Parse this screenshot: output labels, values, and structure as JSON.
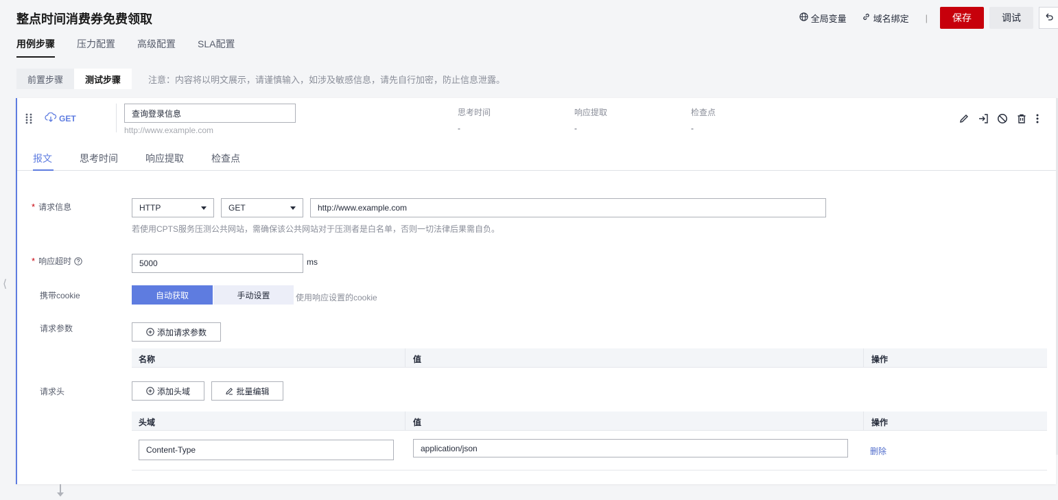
{
  "header": {
    "title": "整点时间消费券免费领取",
    "global_vars": "全局变量",
    "domain_bind": "域名绑定",
    "separator": "|",
    "save": "保存",
    "debug": "调试"
  },
  "main_tabs": [
    {
      "label": "用例步骤",
      "active": true
    },
    {
      "label": "压力配置",
      "active": false
    },
    {
      "label": "高级配置",
      "active": false
    },
    {
      "label": "SLA配置",
      "active": false
    }
  ],
  "sub_tabs": [
    {
      "label": "前置步骤",
      "active": false
    },
    {
      "label": "测试步骤",
      "active": true
    }
  ],
  "sub_note": "注意：内容将以明文展示，请谨慎输入，如涉及敏感信息，请先自行加密，防止信息泄露。",
  "step": {
    "method": "GET",
    "name": "查询登录信息",
    "url": "http://www.example.com",
    "meta": [
      {
        "label": "思考时间",
        "value": "-"
      },
      {
        "label": "响应提取",
        "value": "-"
      },
      {
        "label": "检查点",
        "value": "-"
      }
    ]
  },
  "inner_tabs": [
    {
      "label": "报文",
      "active": true
    },
    {
      "label": "思考时间",
      "active": false
    },
    {
      "label": "响应提取",
      "active": false
    },
    {
      "label": "检查点",
      "active": false
    }
  ],
  "form": {
    "request_info_label": "请求信息",
    "protocol": "HTTP",
    "method": "GET",
    "url_value": "http://www.example.com",
    "url_hint": "若使用CPTS服务压测公共网站，需确保该公共网站对于压测者是白名单，否则一切法律后果需自负。",
    "timeout_label": "响应超时",
    "timeout_value": "5000",
    "timeout_unit": "ms",
    "cookie_label": "携带cookie",
    "cookie_auto": "自动获取",
    "cookie_manual": "手动设置",
    "cookie_hint": "使用响应设置的cookie",
    "params_label": "请求参数",
    "add_param": "添加请求参数",
    "params_cols": {
      "name": "名称",
      "value": "值",
      "op": "操作"
    },
    "headers_label": "请求头",
    "add_header": "添加头域",
    "batch_edit": "批量编辑",
    "headers_cols": {
      "name": "头域",
      "value": "值",
      "op": "操作"
    },
    "headers_rows": [
      {
        "name": "Content-Type",
        "value": "application/json",
        "op": "删除"
      }
    ]
  },
  "colors": {
    "primary": "#5e7ce0",
    "danger": "#c7000b"
  }
}
